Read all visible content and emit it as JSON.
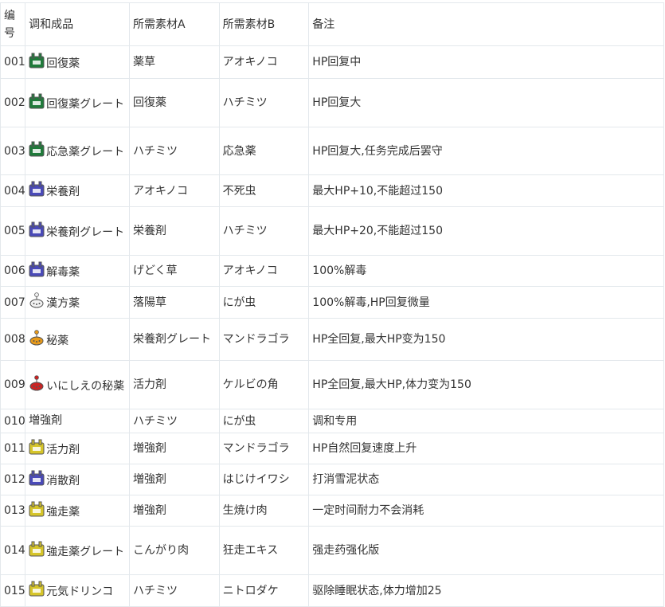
{
  "headers": [
    "编号",
    "调和成品",
    "所需素材A",
    "所需素材B",
    "备注"
  ],
  "rows": [
    {
      "no": "001",
      "icon": "bottle-green-icon",
      "name": "回復薬",
      "a": "薬草",
      "b": "アオキノコ",
      "note": "HP回复中",
      "h": 41
    },
    {
      "no": "002",
      "icon": "bottle-green-icon",
      "name": "回復薬グレート",
      "a": "回復薬",
      "b": "ハチミツ",
      "note": "HP回复大",
      "h": 61
    },
    {
      "no": "003",
      "icon": "bottle-green-icon",
      "name": "応急薬グレート",
      "a": "ハチミツ",
      "b": "応急薬",
      "note": "HP回复大,任务完成后罢守",
      "h": 60
    },
    {
      "no": "004",
      "icon": "bottle-blue-icon",
      "name": "栄養剤",
      "a": "アオキノコ",
      "b": "不死虫",
      "note": "最大HP+10,不能超过150",
      "h": 40
    },
    {
      "no": "005",
      "icon": "bottle-blue-icon",
      "name": "栄養剤グレート",
      "a": "栄養剤",
      "b": "ハチミツ",
      "note": "最大HP+20,不能超过150",
      "h": 61
    },
    {
      "no": "006",
      "icon": "bottle-blue-icon",
      "name": "解毒薬",
      "a": "げどく草",
      "b": "アオキノコ",
      "note": "100%解毒",
      "h": 39
    },
    {
      "no": "007",
      "icon": "herb-sack-white-icon",
      "name": "漢方薬",
      "a": "落陽草",
      "b": "にが虫",
      "note": "100%解毒,HP回复微量",
      "h": 40
    },
    {
      "no": "008",
      "icon": "herb-sack-orange-icon",
      "name": "秘薬",
      "a": "栄養剤グレート",
      "b": "マンドラゴラ",
      "note": "HP全回复,最大HP变为150",
      "h": 53
    },
    {
      "no": "009",
      "icon": "herb-sack-red-icon",
      "name": "いにしえの秘薬",
      "a": "活力剤",
      "b": "ケルビの角",
      "note": "HP全回复,最大HP,体力变为150",
      "h": 61
    },
    {
      "no": "010",
      "icon": "",
      "name": "増強剤",
      "a": "ハチミツ",
      "b": "にが虫",
      "note": "调和专用",
      "h": 30
    },
    {
      "no": "011",
      "icon": "bottle-yellow-icon",
      "name": "活力剤",
      "a": "増強剤",
      "b": "マンドラゴラ",
      "note": "HP自然回复速度上升",
      "h": 39
    },
    {
      "no": "012",
      "icon": "bottle-blue-icon",
      "name": "消散剤",
      "a": "増強剤",
      "b": "はじけイワシ",
      "note": "打消雪泥状态",
      "h": 39
    },
    {
      "no": "013",
      "icon": "bottle-yellow-icon",
      "name": "強走薬",
      "a": "増強剤",
      "b": "生焼け肉",
      "note": "一定时间耐力不会消耗",
      "h": 39
    },
    {
      "no": "014",
      "icon": "bottle-yellow-icon",
      "name": "強走薬グレート",
      "a": "こんがり肉",
      "b": "狂走エキス",
      "note": "强走药强化版",
      "h": 61
    },
    {
      "no": "015",
      "icon": "bottle-yellow-icon",
      "name": "元気ドリンコ",
      "a": "ハチミツ",
      "b": "ニトロダケ",
      "note": "驱除睡眠状态,体力增加25",
      "h": 40
    }
  ],
  "colors": {
    "border": "#e3e8ec",
    "text": "#333333",
    "green": "#1f7a3a",
    "blue": "#4a4ab8",
    "yellow": "#d6c52a",
    "orange": "#e89a1a",
    "red": "#cc2222",
    "white": "#f2f2f2"
  }
}
